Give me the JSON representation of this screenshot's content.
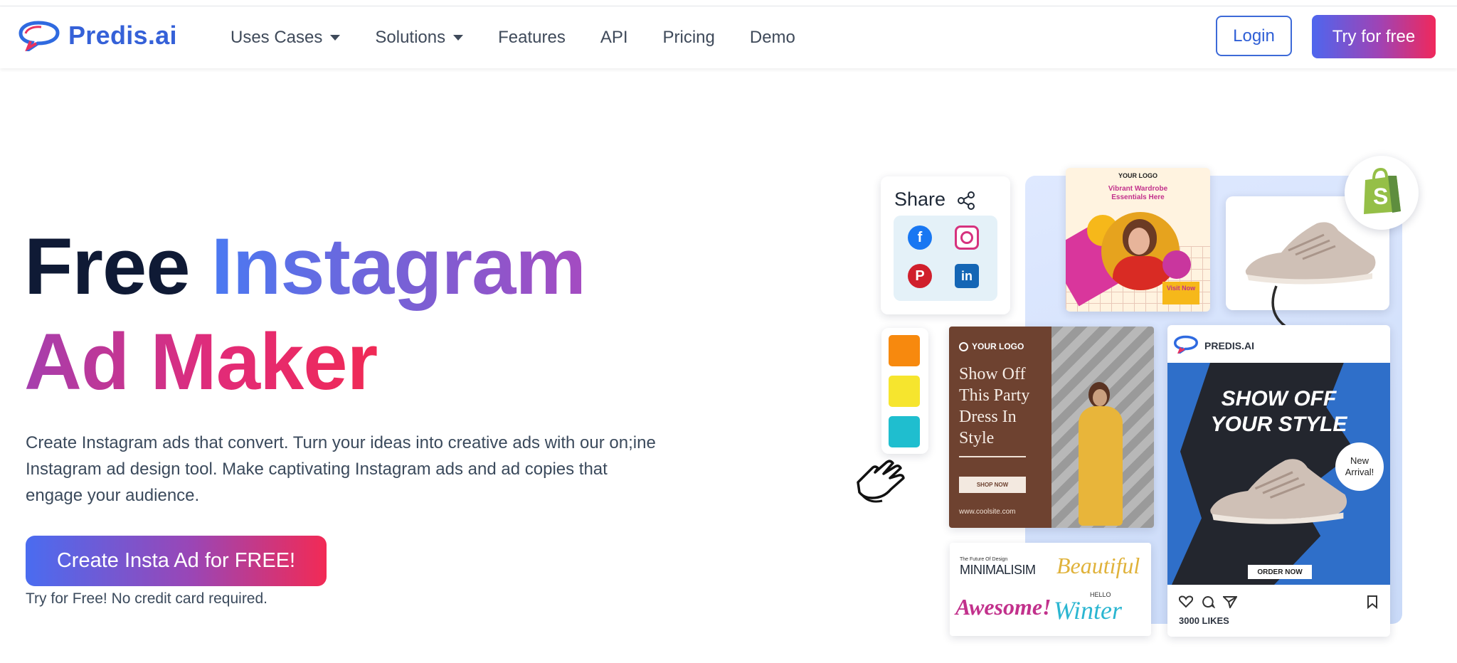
{
  "brand": {
    "name": "Predis.ai",
    "logo": "speech-bubble-logo"
  },
  "nav": {
    "items": [
      {
        "label": "Uses Cases",
        "dropdown": true
      },
      {
        "label": "Solutions",
        "dropdown": true
      },
      {
        "label": "Features",
        "dropdown": false
      },
      {
        "label": "API",
        "dropdown": false
      },
      {
        "label": "Pricing",
        "dropdown": false
      },
      {
        "label": "Demo",
        "dropdown": false
      }
    ],
    "login": "Login",
    "try_free": "Try for free"
  },
  "hero": {
    "title_word1": "Free",
    "title_word2": "Instagram",
    "title_line2": "Ad Maker",
    "description": "Create Instagram ads that convert. Turn your ideas into creative ads with our on;ine Instagram ad design tool. Make captivating Instagram ads and ad copies that engage your audience.",
    "cta": "Create Insta Ad for FREE!",
    "cta_note": "Try for Free! No credit card required."
  },
  "collage": {
    "share_label": "Share",
    "social_icons": [
      "facebook-icon",
      "instagram-icon",
      "pinterest-icon",
      "linkedin-icon"
    ],
    "swatch_colors": [
      "#f7890e",
      "#f6e52e",
      "#1fbecf"
    ],
    "wardrobe_card": {
      "logo": "YOUR LOGO",
      "headline": "Vibrant Wardrobe Essentials Here",
      "button": "Visit Now"
    },
    "party_card": {
      "logo": "YOUR LOGO",
      "headline": "Show Off This Party Dress In Style",
      "button": "SHOP NOW",
      "url": "www.coolsite.com"
    },
    "fonts_card": {
      "caption": "The Future Of Design",
      "word1": "MINIMALISIM",
      "word2": "Beautiful",
      "word3": "Awesome!",
      "word4_small": "HELLO",
      "word4": "Winter"
    },
    "post": {
      "account": "PREDIS.AI",
      "headline_line1": "SHOW OFF",
      "headline_line2": "YOUR STYLE",
      "badge_line1": "New",
      "badge_line2": "Arrival!",
      "button": "ORDER NOW",
      "likes": "3000 LIKES"
    }
  }
}
